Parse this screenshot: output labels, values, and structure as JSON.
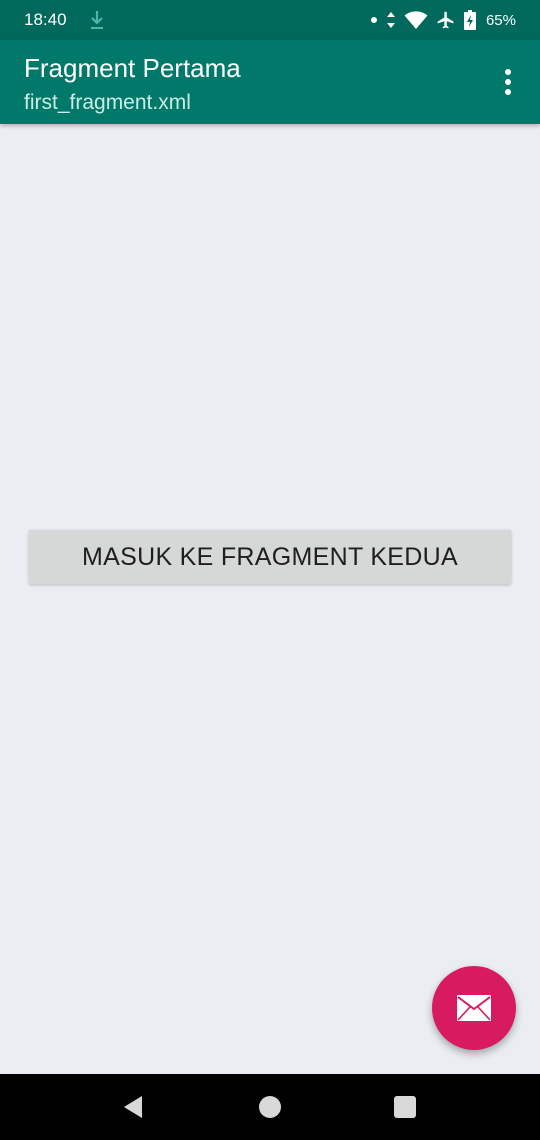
{
  "status_bar": {
    "time": "18:40",
    "battery": "65%",
    "icons": [
      "download-icon",
      "dot-icon",
      "data-arrows-icon",
      "wifi-icon",
      "airplane-icon",
      "battery-charging-icon"
    ]
  },
  "app_bar": {
    "title": "Fragment Pertama",
    "subtitle": "first_fragment.xml",
    "menu_icon": "more-vert-icon"
  },
  "main": {
    "button_label": "MASUK KE FRAGMENT KEDUA"
  },
  "fab": {
    "icon": "email-icon"
  },
  "nav_bar": {
    "icons": [
      "back-icon",
      "home-icon",
      "recents-icon"
    ]
  },
  "colors": {
    "status_bar": "#00695c",
    "app_bar": "#00796b",
    "background": "#eaeef2",
    "button": "#d6d7d7",
    "fab": "#d81b60",
    "nav_bar": "#000000"
  }
}
